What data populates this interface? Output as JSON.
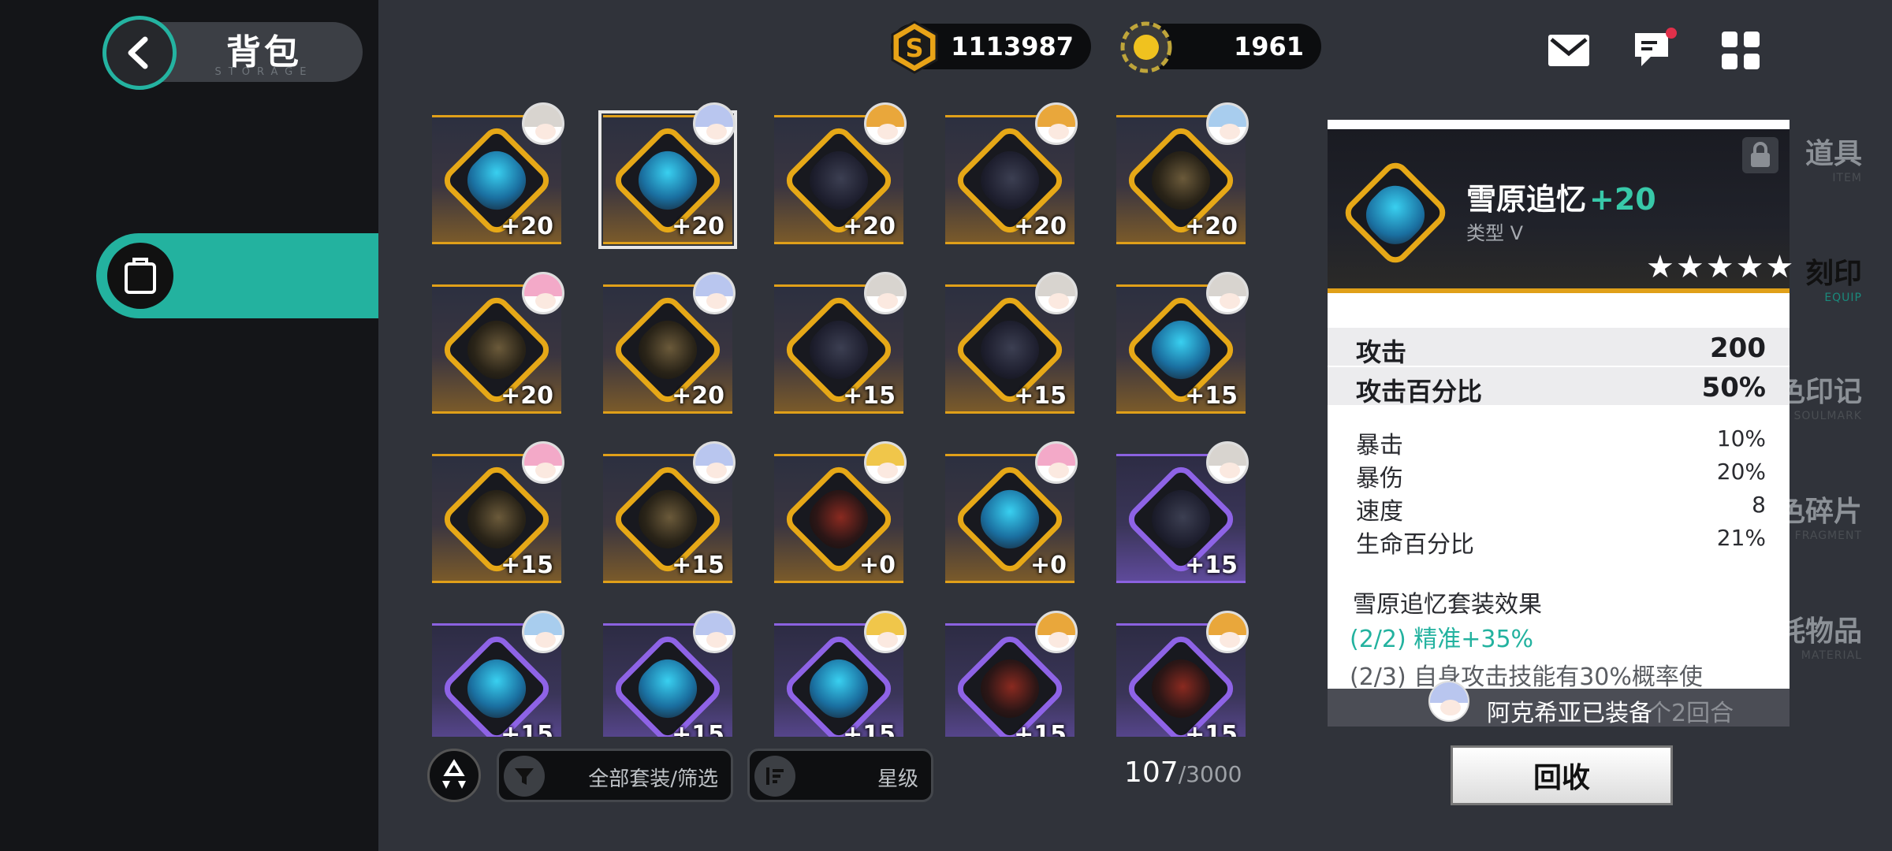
{
  "header": {
    "title": "背包",
    "subtitle": "STORAGE"
  },
  "sidebar": {
    "items": [
      {
        "label": "道具",
        "sub": "ITEM",
        "active": false
      },
      {
        "label": "刻印",
        "sub": "EQUIP",
        "active": true
      },
      {
        "label": "角色印记",
        "sub": "SOULMARK",
        "active": false
      },
      {
        "label": "角色碎片",
        "sub": "FRAGMENT",
        "active": false
      },
      {
        "label": "消耗物品",
        "sub": "MATERIAL",
        "active": false
      }
    ]
  },
  "currency": {
    "gold": "1113987",
    "coin": "1961",
    "gold_icon": "s-coin-icon",
    "coin_icon": "sun-coin-icon"
  },
  "top_icons": [
    "mail-icon",
    "chat-icon",
    "grid-menu-icon"
  ],
  "items": [
    {
      "level": "+20",
      "rarity": "gold",
      "art": "cyan",
      "avatar": "white",
      "selected": false
    },
    {
      "level": "+20",
      "rarity": "gold",
      "art": "cyan",
      "avatar": "lavender",
      "selected": true
    },
    {
      "level": "+20",
      "rarity": "gold",
      "art": "dark",
      "avatar": "orange",
      "selected": false
    },
    {
      "level": "+20",
      "rarity": "gold",
      "art": "dark",
      "avatar": "orange",
      "selected": false
    },
    {
      "level": "+20",
      "rarity": "gold",
      "art": "gold",
      "avatar": "lightblue",
      "selected": false
    },
    {
      "level": "+20",
      "rarity": "gold",
      "art": "gold",
      "avatar": "pink",
      "selected": false
    },
    {
      "level": "+20",
      "rarity": "gold",
      "art": "gold",
      "avatar": "lavender",
      "selected": false
    },
    {
      "level": "+15",
      "rarity": "gold",
      "art": "dark",
      "avatar": "white",
      "selected": false
    },
    {
      "level": "+15",
      "rarity": "gold",
      "art": "dark",
      "avatar": "white",
      "selected": false
    },
    {
      "level": "+15",
      "rarity": "gold",
      "art": "cyan",
      "avatar": "white",
      "selected": false
    },
    {
      "level": "+15",
      "rarity": "gold",
      "art": "gold",
      "avatar": "pink",
      "selected": false
    },
    {
      "level": "+15",
      "rarity": "gold",
      "art": "gold",
      "avatar": "lavender",
      "selected": false
    },
    {
      "level": "+0",
      "rarity": "gold",
      "art": "red",
      "avatar": "gold",
      "selected": false
    },
    {
      "level": "+0",
      "rarity": "gold",
      "art": "cyan",
      "avatar": "pink",
      "selected": false
    },
    {
      "level": "+15",
      "rarity": "purple",
      "art": "dark",
      "avatar": "white",
      "selected": false
    },
    {
      "level": "+15",
      "rarity": "purple",
      "art": "cyan",
      "avatar": "lightblue",
      "selected": false
    },
    {
      "level": "+15",
      "rarity": "purple",
      "art": "cyan",
      "avatar": "lavender",
      "selected": false
    },
    {
      "level": "+15",
      "rarity": "purple",
      "art": "cyan",
      "avatar": "gold",
      "selected": false
    },
    {
      "level": "+15",
      "rarity": "purple",
      "art": "red",
      "avatar": "orange",
      "selected": false
    },
    {
      "level": "+15",
      "rarity": "purple",
      "art": "red",
      "avatar": "orange",
      "selected": false
    }
  ],
  "filters": {
    "set_filter_label": "全部套装/筛选",
    "sort_label": "星级"
  },
  "count": {
    "current": "107",
    "total": "/3000"
  },
  "detail": {
    "name": "雪原追忆",
    "plus": "+20",
    "type": "类型 V",
    "stars": "★★★★★",
    "main_stats": [
      {
        "label": "攻击",
        "value": "200"
      },
      {
        "label": "攻击百分比",
        "value": "50%"
      }
    ],
    "sub_stats": [
      {
        "label": "暴击",
        "value": "10%"
      },
      {
        "label": "暴伤",
        "value": "20%"
      },
      {
        "label": "速度",
        "value": "8"
      },
      {
        "label": "生命百分比",
        "value": "21%"
      }
    ],
    "set_title": "雪原追忆套装效果",
    "set_line1": "(2/2)  精准+35%",
    "set_line2": "(2/3)  自身攻击技能有30%概率使",
    "set_line3_partial": "个2回合",
    "equipped_text": "阿克希亚已装备"
  },
  "recover_button": "回收",
  "colors": {
    "accent_teal": "#23b29f",
    "gold_rarity": "#e0a019",
    "purple_rarity": "#8b62e0"
  }
}
